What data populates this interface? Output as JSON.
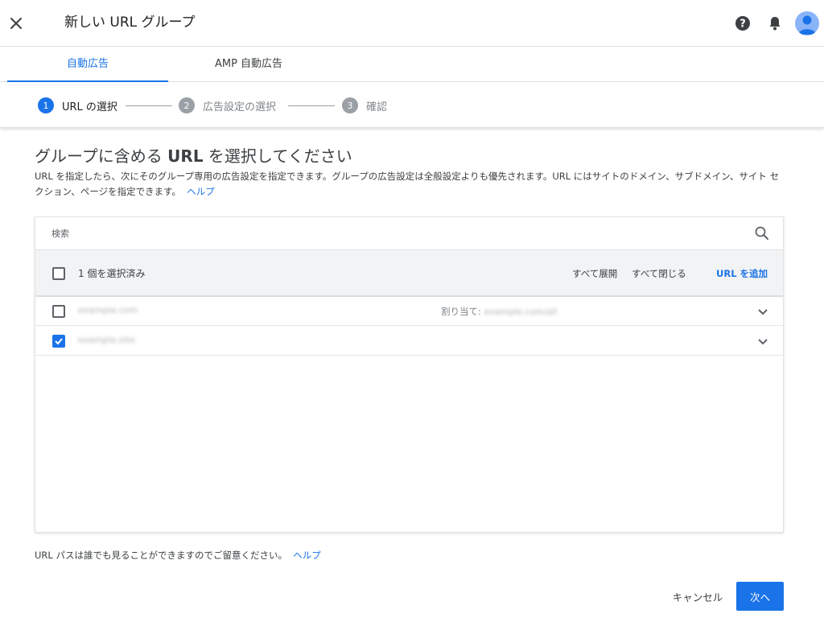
{
  "header": {
    "title": "新しい URL グループ"
  },
  "tabs": [
    {
      "label": "自動広告"
    },
    {
      "label": "AMP 自動広告"
    }
  ],
  "steps": [
    {
      "num": "1",
      "label": "URL の選択"
    },
    {
      "num": "2",
      "label": "広告設定の選択"
    },
    {
      "num": "3",
      "label": "確認"
    }
  ],
  "main": {
    "heading_prefix": "グループに含める ",
    "heading_bold": "URL",
    "heading_suffix": " を選択してください",
    "description": "URL を指定したら、次にそのグループ専用の広告設定を指定できます。グループの広告設定は全般設定よりも優先されます。URL にはサイトのドメイン、サブドメイン、サイト セクション、ページを指定できます。",
    "help_link": "ヘルプ"
  },
  "list": {
    "search_placeholder": "検索",
    "selected_count": "1 個を選択済み",
    "expand_all": "すべて展開",
    "collapse_all": "すべて閉じる",
    "add_url": "URL を追加",
    "rows": [
      {
        "url": "example.com",
        "checked": false,
        "assigned_label": "割り当て:",
        "assigned_value": "example.com/all"
      },
      {
        "url": "example.site",
        "checked": true,
        "assigned_label": "",
        "assigned_value": ""
      }
    ]
  },
  "footer": {
    "note": "URL パスは誰でも見ることができますのでご留意ください。",
    "help_link": "ヘルプ",
    "cancel": "キャンセル",
    "next": "次へ"
  },
  "colors": {
    "accent": "#1a73e8",
    "step_idle": "#9aa0a6",
    "header_bg": "#f1f3f4"
  }
}
